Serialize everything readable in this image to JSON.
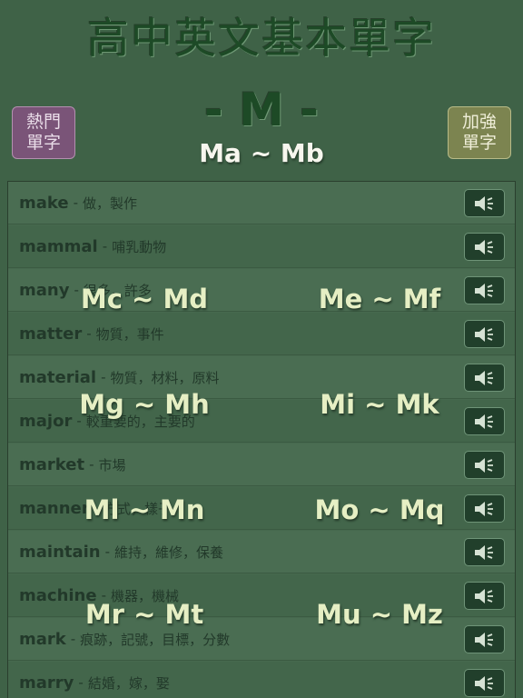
{
  "header": {
    "app_title": "高中英文基本單字",
    "letter_heading": "- M -",
    "range_title": "Ma ~ Mb",
    "hot_words_label": [
      "熱門",
      "單字"
    ],
    "advanced_words_label": [
      "加強",
      "單字"
    ]
  },
  "words": [
    {
      "word": "make",
      "meaning": "做，製作"
    },
    {
      "word": "mammal",
      "meaning": "哺乳動物"
    },
    {
      "word": "many",
      "meaning": "很多，許多"
    },
    {
      "word": "matter",
      "meaning": "物質，事件"
    },
    {
      "word": "material",
      "meaning": "物質，材料，原料"
    },
    {
      "word": "major",
      "meaning": "較重要的，主要的"
    },
    {
      "word": "market",
      "meaning": "市場"
    },
    {
      "word": "manner",
      "meaning": "方式，樣子"
    },
    {
      "word": "maintain",
      "meaning": "維持，維修，保養"
    },
    {
      "word": "machine",
      "meaning": "機器，機械"
    },
    {
      "word": "mark",
      "meaning": "痕跡，記號，目標，分數"
    },
    {
      "word": "marry",
      "meaning": "結婚，嫁，娶"
    }
  ],
  "separator": "-",
  "speaker_icon": "speaker-icon",
  "range_buttons": [
    "Mc ~ Md",
    "Me ~ Mf",
    "Mg ~ Mh",
    "Mi ~ Mk",
    "Ml ~ Mn",
    "Mo ~ Mq",
    "Mr ~ Mt",
    "Mu ~ Mz"
  ],
  "colors": {
    "background": "#3f6247",
    "title_green": "#1d4a26",
    "hot_button": "#7a5478",
    "advanced_button": "#7c8450",
    "speaker_button": "#213f2b",
    "overlay_text": "#e6efc4"
  }
}
